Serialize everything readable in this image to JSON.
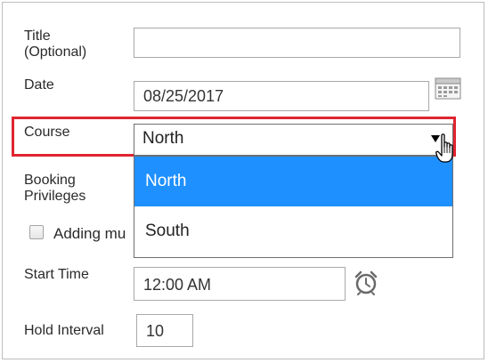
{
  "form": {
    "title_label": "Title\n(Optional)",
    "title_value": "",
    "date_label": "Date",
    "date_value": "08/25/2017",
    "course_label": "Course",
    "course_value": "North",
    "booking_label": "Booking\nPrivileges",
    "adding_label": "Adding mu",
    "start_time_label": "Start Time",
    "start_time_value": "12:00 AM",
    "hold_interval_label": "Hold Interval",
    "hold_interval_value": "10"
  },
  "dropdown": {
    "options": [
      "North",
      "South"
    ],
    "selected": "North"
  },
  "icons": {
    "calendar": "calendar-icon",
    "clock": "alarm-clock-icon",
    "cursor": "hand-pointer-icon",
    "caret": "chevron-down-icon"
  },
  "colors": {
    "highlight_border": "#e02531",
    "selected_option_bg": "#1e90ff"
  }
}
